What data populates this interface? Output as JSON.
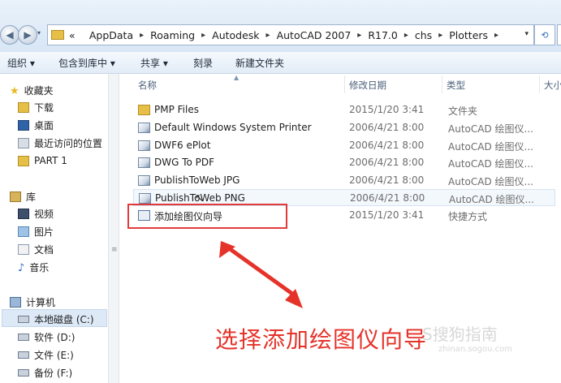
{
  "address_bar": {
    "back_glyph": "◀",
    "forward_glyph": "▶",
    "overflow": "«",
    "path": [
      "AppData",
      "Roaming",
      "Autodesk",
      "AutoCAD 2007",
      "R17.0",
      "chs",
      "Plotters"
    ],
    "separator": "▸",
    "dropdown_glyph": "▾",
    "refresh_glyph": "⟲"
  },
  "toolbar": {
    "organize": "组织 ▾",
    "include_in_library": "包含到库中 ▾",
    "share": "共享 ▾",
    "burn": "刻录",
    "new_folder": "新建文件夹"
  },
  "sidebar": {
    "favorites": "收藏夹",
    "downloads": "下载",
    "desktop": "桌面",
    "recent": "最近访问的位置",
    "part1": "PART 1",
    "libraries": "库",
    "videos": "视频",
    "pictures": "图片",
    "documents": "文档",
    "music": "音乐",
    "computer": "计算机",
    "local_disk_c": "本地磁盘 (C:)",
    "software_d": "软件 (D:)",
    "files_e": "文件 (E:)",
    "backup_f": "备份 (F:)"
  },
  "columns": {
    "name": "名称",
    "modified": "修改日期",
    "type": "类型",
    "size": "大小"
  },
  "files": [
    {
      "name": "PMP Files",
      "date": "2015/1/20 3:41",
      "type": "文件夹",
      "icon": "folder-icon"
    },
    {
      "name": "Default Windows System Printer",
      "date": "2006/4/21 8:00",
      "type": "AutoCAD 绘图仪...",
      "icon": "plotter-icon"
    },
    {
      "name": "DWF6 ePlot",
      "date": "2006/4/21 8:00",
      "type": "AutoCAD 绘图仪...",
      "icon": "plotter-icon"
    },
    {
      "name": "DWG To PDF",
      "date": "2006/4/21 8:00",
      "type": "AutoCAD 绘图仪...",
      "icon": "plotter-icon"
    },
    {
      "name": "PublishToWeb JPG",
      "date": "2006/4/21 8:00",
      "type": "AutoCAD 绘图仪...",
      "icon": "plotter-icon"
    },
    {
      "name": "PublishToWeb PNG",
      "date": "2006/4/21 8:00",
      "type": "AutoCAD 绘图仪...",
      "icon": "plotter-icon"
    },
    {
      "name": "添加绘图仪向导",
      "date": "2015/1/20 3:41",
      "type": "快捷方式",
      "icon": "wizard-shortcut-icon"
    }
  ],
  "annotation": {
    "caption": "选择添加绘图仪向导",
    "highlight_color": "#e23a3a",
    "arrow_color": "#e5332a"
  },
  "watermark": {
    "line1": "S搜狗指南",
    "line2": "zhinan.sogou.com"
  }
}
